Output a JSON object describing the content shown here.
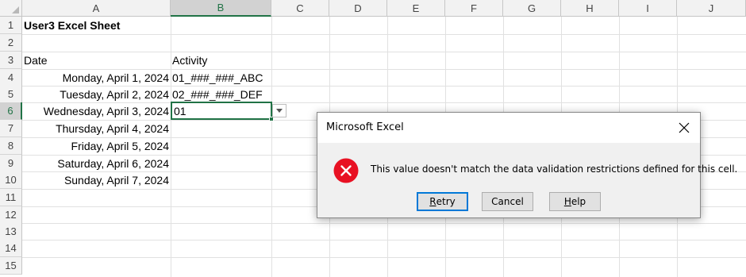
{
  "columns": [
    "A",
    "B",
    "C",
    "D",
    "E",
    "F",
    "G",
    "H",
    "I",
    "J"
  ],
  "rows": [
    "1",
    "2",
    "3",
    "4",
    "5",
    "6",
    "7",
    "8",
    "9",
    "10",
    "11",
    "12",
    "13",
    "14",
    "15"
  ],
  "selected_column": "B",
  "selected_row": "6",
  "cells": {
    "A1": "User3 Excel Sheet",
    "A3": "Date",
    "B3": "Activity",
    "A4": "Monday, April 1, 2024",
    "B4": "01_###_###_ABC",
    "A5": "Tuesday, April 2, 2024",
    "B5": "02_###_###_DEF",
    "A6": "Wednesday, April 3, 2024",
    "B6": "01",
    "A7": "Thursday, April 4, 2024",
    "A8": "Friday, April 5, 2024",
    "A9": "Saturday, April 6, 2024",
    "A10": "Sunday, April 7, 2024"
  },
  "dialog": {
    "title": "Microsoft Excel",
    "message": "This value doesn't match the data validation restrictions defined for this cell.",
    "buttons": {
      "retry_mnemonic": "R",
      "retry_rest": "etry",
      "cancel": "Cancel",
      "help_mnemonic": "H",
      "help_rest": "elp"
    },
    "icon": "error-icon",
    "colors": {
      "error": "#e81123",
      "accent": "#0078d7"
    }
  },
  "colors": {
    "selection": "#217346"
  }
}
